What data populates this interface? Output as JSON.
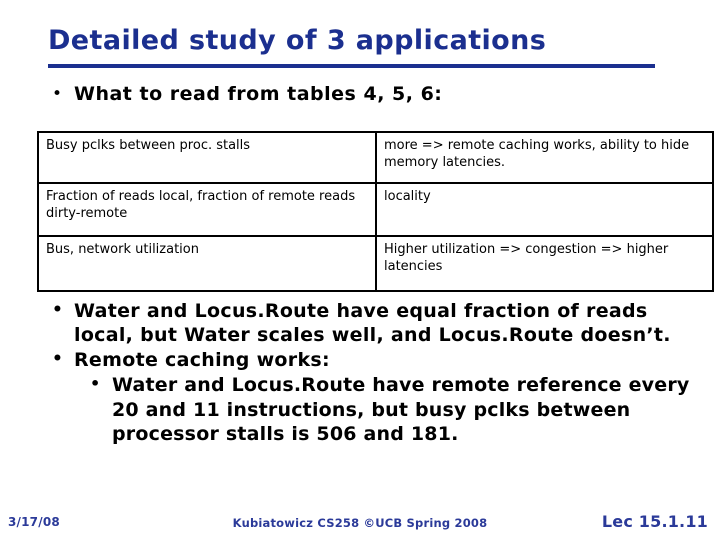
{
  "slide": {
    "title": "Detailed study of 3 applications",
    "top_bullet": {
      "marker": "•",
      "text": "What to read from tables 4, 5, 6:"
    },
    "table": {
      "rows": [
        {
          "metric": "Busy pclks between proc. stalls",
          "meaning": "more => remote caching works, ability to hide memory latencies."
        },
        {
          "metric": "Fraction of reads local, fraction of remote reads dirty-remote",
          "meaning": "locality"
        },
        {
          "metric": "Bus, network utilization",
          "meaning": "Higher utilization => congestion => higher latencies"
        }
      ]
    },
    "bullets": [
      {
        "level": 1,
        "marker": "•",
        "text": "Water and Locus.Route have equal fraction of reads local, but Water scales well, and Locus.Route doesn’t."
      },
      {
        "level": 1,
        "marker": "•",
        "text": "Remote caching works:"
      },
      {
        "level": 2,
        "marker": "•",
        "text": "Water and Locus.Route have remote reference every 20 and 11 instructions, but busy pclks between processor stalls is 506 and 181."
      }
    ],
    "footer": {
      "date": "3/17/08",
      "center": "Kubiatowicz CS258 ©UCB Spring 2008",
      "lecture": "Lec 15.1.11"
    },
    "colors": {
      "title_blue": "#1b2f8f",
      "footer_blue": "#2b3a99",
      "table_border": "#000000",
      "body_text": "#000000",
      "background": "#ffffff"
    }
  }
}
